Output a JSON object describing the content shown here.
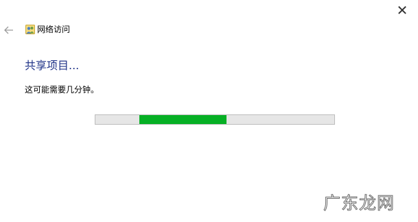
{
  "window": {
    "title": "网络访问",
    "close_label": "✕",
    "back_icon": "back-arrow-icon",
    "title_icon": "network-users-icon"
  },
  "main": {
    "heading": "共享项目...",
    "description": "这可能需要几分钟。"
  },
  "progress": {
    "indeterminate": true,
    "segment_start": 0.185,
    "segment_end": 0.55,
    "track_color": "#e6e6e6",
    "fill_color": "#06b025"
  },
  "colors": {
    "heading": "#1e3287",
    "text": "#000000"
  },
  "watermark": {
    "text": "广东龙网"
  }
}
